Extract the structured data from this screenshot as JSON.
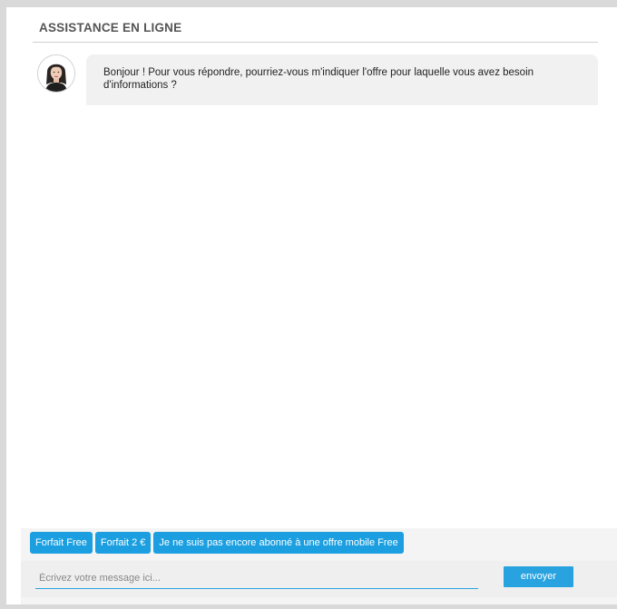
{
  "header": {
    "title": "ASSISTANCE EN LIGNE"
  },
  "conversation": {
    "messages": [
      {
        "sender": "agent",
        "avatar_icon": "agent-avatar",
        "text": "Bonjour ! Pour vous répondre, pourriez-vous m'indiquer l'offre pour laquelle vous avez besoin d'informations ?"
      }
    ]
  },
  "quick_replies": [
    {
      "label": "Forfait Free"
    },
    {
      "label": "Forfait 2 €"
    },
    {
      "label": "Je ne suis pas encore abonné à une offre mobile Free"
    }
  ],
  "composer": {
    "placeholder": "Écrivez votre message ici...",
    "value": "",
    "send_label": "envoyer"
  },
  "colors": {
    "accent": "#1b9fe0",
    "bubble": "#f1f1f1",
    "background": "#d9d9d9"
  }
}
